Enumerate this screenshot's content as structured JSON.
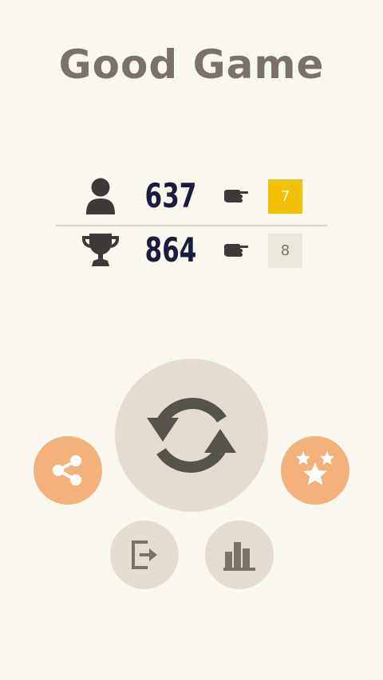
{
  "title": "Good Game",
  "scores": {
    "current": {
      "icon": "person-icon",
      "value": "637",
      "pointer_icon": "pointing-hand-icon",
      "level": "7",
      "level_color": "#f1c000"
    },
    "best": {
      "icon": "trophy-icon",
      "value": "864",
      "pointer_icon": "pointing-hand-icon",
      "level": "8",
      "level_color": "#ece7dd"
    }
  },
  "buttons": {
    "replay": {
      "icon": "refresh-icon",
      "color": "#e4dccf"
    },
    "share": {
      "icon": "share-icon",
      "color": "#f3b27b"
    },
    "rate": {
      "icon": "stars-icon",
      "color": "#f3b27b"
    },
    "exit": {
      "icon": "exit-icon",
      "color": "#e4dccf"
    },
    "stats": {
      "icon": "bar-chart-icon",
      "color": "#e4dccf"
    }
  },
  "colors": {
    "background": "#faf7ee",
    "title": "#7a7268",
    "score_text": "#1b1b3e",
    "icon_dark": "#5a5550"
  }
}
